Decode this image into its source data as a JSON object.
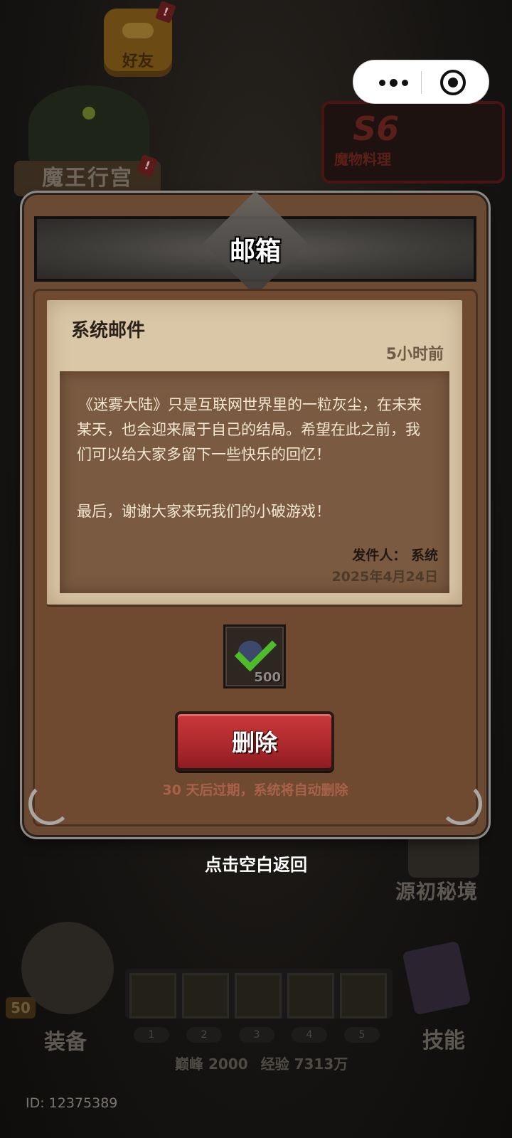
{
  "background": {
    "friends_label": "好友",
    "badge": "!",
    "demon_palace_label": "魔王行宫",
    "event_title": "S6",
    "event_subtitle": "魔物料理",
    "secret_realm_label": "源初秘境",
    "level": "50",
    "equip_label": "装备",
    "skill_label": "技能",
    "slot_numbers": [
      "1",
      "2",
      "3",
      "4",
      "5"
    ],
    "peak": "巅峰 2000",
    "exp": "经验 7313万",
    "user_id": "ID: 12375389"
  },
  "capsule": {
    "more_icon": "more-dots-icon",
    "close_icon": "target-close-icon"
  },
  "mailbox": {
    "title": "邮箱",
    "mail": {
      "type": "系统邮件",
      "time": "5小时前",
      "paragraph1": "《迷雾大陆》只是互联网世界里的一粒灰尘，在未来某天，也会迎来属于自己的结局。希望在此之前，我们可以给大家多留下一些快乐的回忆！",
      "paragraph2": "最后，谢谢大家来玩我们的小破游戏！",
      "sender": "发件人：  系统",
      "date": "2025年4月24日"
    },
    "attachment": {
      "quantity": "500",
      "claimed": true
    },
    "delete_label": "删除",
    "expire_note": "30 天后过期，系统将自动删除"
  },
  "tap_back": "点击空白返回"
}
